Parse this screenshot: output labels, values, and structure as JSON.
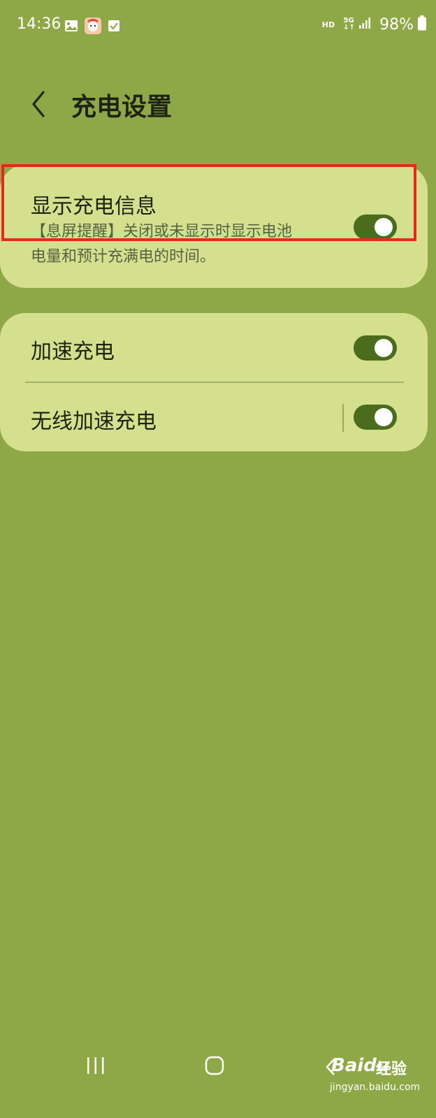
{
  "status_bar": {
    "time": "14:36",
    "notification_icons": [
      "gallery-icon",
      "app-avatar-icon",
      "checkbox-icon"
    ],
    "hd_label": "HD",
    "network_label": "5G",
    "battery_percent": "98%"
  },
  "header": {
    "title": "充电设置"
  },
  "settings": {
    "show_charging_info": {
      "title": "显示充电信息",
      "description_line1": "【息屏提醒】关闭或未显示时显示电池",
      "description_line2": "电量和预计充满电的时间。",
      "enabled": true
    },
    "fast_charging": {
      "title": "加速充电",
      "enabled": true
    },
    "wireless_fast_charging": {
      "title": "无线加速充电",
      "enabled": true
    }
  },
  "watermark": {
    "brand": "Baidu",
    "cn_text": "经验",
    "url": "jingyan.baidu.com"
  },
  "colors": {
    "background": "#8fa847",
    "card": "#d4e08e",
    "toggle_on": "#4b6b1d",
    "highlight": "#e8281e"
  }
}
